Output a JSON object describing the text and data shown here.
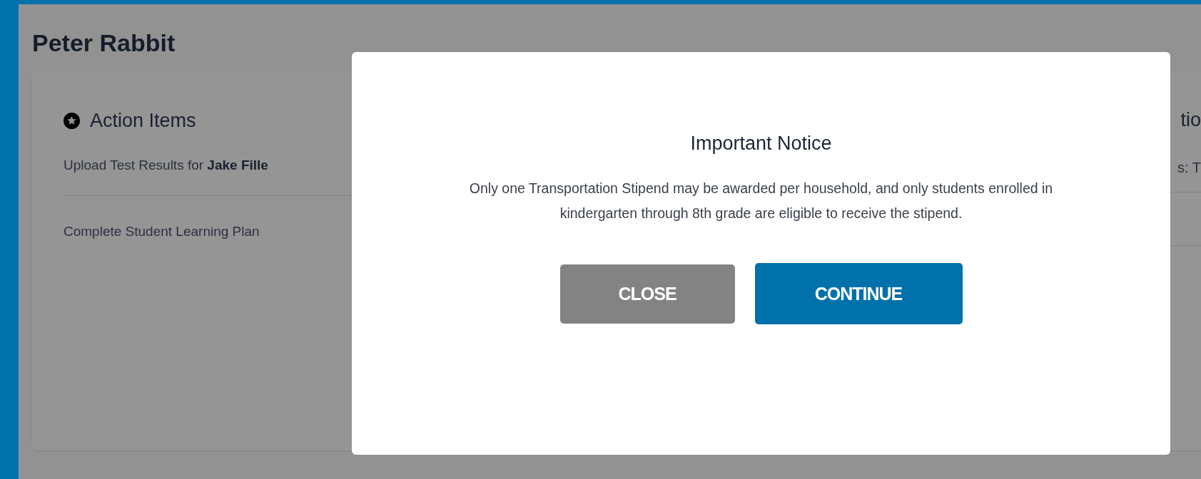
{
  "page": {
    "title": "Peter Rabbit"
  },
  "action_card": {
    "title": "Action Items",
    "items": [
      {
        "text": "Upload Test Results for **Jake Fille**"
      },
      {
        "text": "Complete Student Learning Plan"
      }
    ]
  },
  "side_card": {
    "title": "tio",
    "items": [
      {
        "text": "s: T"
      }
    ]
  },
  "modal": {
    "title": "Important Notice",
    "message": "Only one Transportation Stipend may be awarded per household, and only students enrolled in kindergarten through 8th grade are eligible to receive the stipend.",
    "buttons": [
      {
        "label": "CLOSE",
        "kind": "secondary"
      },
      {
        "label": "CONTINUE",
        "kind": "primary"
      }
    ]
  }
}
